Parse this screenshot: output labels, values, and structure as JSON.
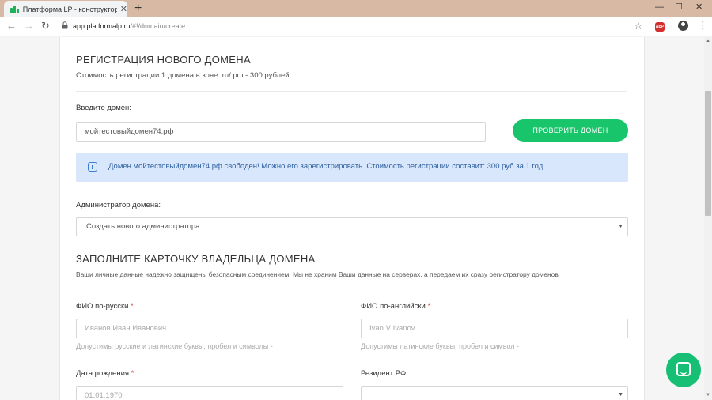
{
  "browser": {
    "tab_title": "Платформа LP - конструктор да",
    "url_host": "app.platformalp.ru",
    "url_path": "/#!/domain/create"
  },
  "colors": {
    "accent": "#18c56a",
    "info_bg": "#d8e7fb",
    "info_text": "#2e5f9e",
    "required": "#e53935"
  },
  "icons": [
    "back-icon",
    "forward-icon",
    "reload-icon",
    "lock-icon",
    "star-icon",
    "adblock-icon",
    "profile-icon",
    "menu-icon",
    "chat-icon"
  ],
  "registration": {
    "title": "РЕГИСТРАЦИЯ НОВОГО ДОМЕНА",
    "subtitle": "Стоимость регистрации 1 домена в зоне .ru/.рф - 300 рублей",
    "domain_label": "Введите домен:",
    "domain_value": "мойтестовыйдомен74.рф",
    "check_button": "ПРОВЕРИТЬ ДОМЕН",
    "alert": "Домен мойтестовыйдомен74.рф свободен! Можно его зарегистрировать. Стоимость регистрации составит: 300 руб за 1 год.",
    "admin_label": "Администратор домена:",
    "admin_selected": "Создать нового администратора"
  },
  "owner": {
    "title": "ЗАПОЛНИТЕ КАРТОЧКУ ВЛАДЕЛЬЦА ДОМЕНА",
    "subtitle": "Ваши личные данные надежно защищены безопасным соединением. Мы не храним Ваши данные на серверах, а передаем их сразу регистратору доменов",
    "fio_ru_label": "ФИО по-русски",
    "fio_ru_placeholder": "Иванов Иван Иванович",
    "fio_ru_hint": "Допустимы русские и латинские буквы, пробел и символы -",
    "fio_en_label": "ФИО по-английски",
    "fio_en_placeholder": "Ivan V Ivanov",
    "fio_en_hint": "Допустимы латинские буквы, пробел и символ -",
    "birth_label": "Дата рождения",
    "birth_placeholder": "01.01.1970",
    "resident_label": "Резидент РФ:",
    "required_mark": "*"
  }
}
